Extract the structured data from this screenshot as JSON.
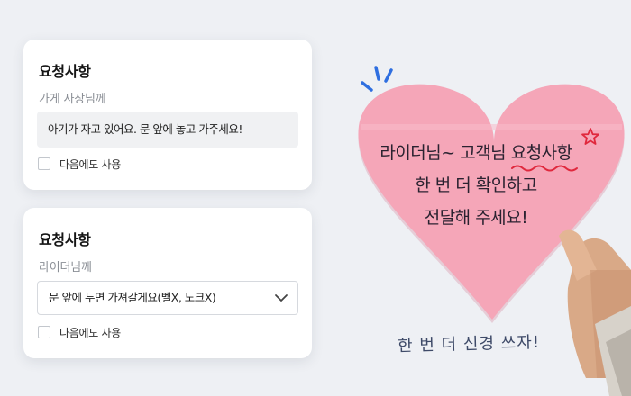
{
  "store_request": {
    "title": "요청사항",
    "subtitle": "가게 사장님께",
    "message": "아기가 자고 있어요. 문 앞에 놓고 가주세요!",
    "reuse_label": "다음에도 사용"
  },
  "rider_request": {
    "title": "요청사항",
    "subtitle": "라이더님께",
    "selected_option": "문 앞에 두면 가져갈게요(벨X, 노크X)",
    "reuse_label": "다음에도 사용"
  },
  "heart_note": {
    "line1_prefix": "라이더님~ 고객님 ",
    "line1_highlight": "요청사항",
    "line2": "한 번 더 확인하고",
    "line3": "전달해 주세요!"
  },
  "tagline": "한 번 더 신경 쓰자!",
  "colors": {
    "background": "#eef0f4",
    "heart_pink": "#f5a6b8",
    "accent_red": "#e0283d",
    "tagline_navy": "#3e4a68",
    "sparkle_blue": "#2f6fe0"
  }
}
